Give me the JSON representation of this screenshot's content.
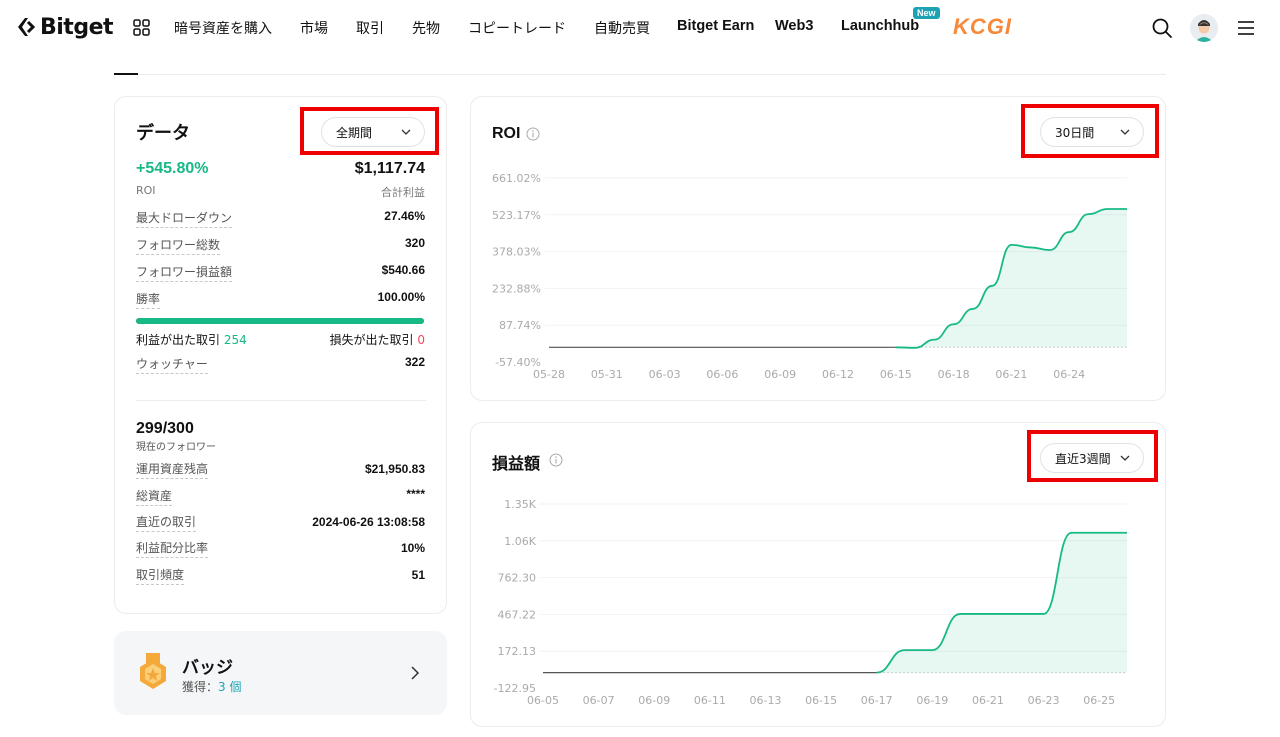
{
  "nav": {
    "brand": "Bitget",
    "items": [
      {
        "label": "暗号資産を購入"
      },
      {
        "label": "市場"
      },
      {
        "label": "取引"
      },
      {
        "label": "先物"
      },
      {
        "label": "コピートレード"
      },
      {
        "label": "自動売買"
      },
      {
        "label": "Bitget Earn"
      },
      {
        "label": "Web3"
      },
      {
        "label": "Launchhub"
      }
    ],
    "new_badge": "New",
    "kcgi": "KCGI",
    "icons": [
      "grid-icon",
      "search-icon",
      "avatar",
      "menu-icon"
    ]
  },
  "data_card": {
    "title": "データ",
    "period": "全期間",
    "roi_value": "+545.80%",
    "roi_label": "ROI",
    "total_profit_value": "$1,117.74",
    "total_profit_label": "合計利益",
    "rows": [
      {
        "label": "最大ドローダウン",
        "value": "27.46%"
      },
      {
        "label": "フォロワー総数",
        "value": "320"
      },
      {
        "label": "フォロワー損益額",
        "value": "$540.66"
      },
      {
        "label": "勝率",
        "value": "100.00%"
      }
    ],
    "win_rate_fraction": 1.0,
    "profit_trades_label": "利益が出た取引",
    "profit_trades_value": "254",
    "loss_trades_label": "損失が出た取引",
    "loss_trades_value": "0",
    "watchers_label": "ウォッチャー",
    "watchers_value": "322",
    "followers_value": "299/300",
    "followers_label": "現在のフォロワー",
    "rows2": [
      {
        "label": "運用資産残高",
        "value": "$21,950.83"
      },
      {
        "label": "総資産",
        "value": "****"
      },
      {
        "label": "直近の取引",
        "value": "2024-06-26 13:08:58"
      },
      {
        "label": "利益配分比率",
        "value": "10%"
      },
      {
        "label": "取引頻度",
        "value": "51"
      }
    ]
  },
  "badge_card": {
    "title": "バッジ",
    "earned_label": "獲得：",
    "earned_value": "3 個"
  },
  "colors": {
    "accent_green": "#17b987",
    "loss_red": "#f6465d",
    "link_teal": "#1da2b4",
    "highlight_red": "#ee0000"
  },
  "chart_data": [
    {
      "type": "area",
      "title": "ROI",
      "period": "30日間",
      "y_ticks": [
        "661.02%",
        "523.17%",
        "378.03%",
        "232.88%",
        "87.74%",
        "-57.40%"
      ],
      "x_ticks": [
        "05-28",
        "05-31",
        "06-03",
        "06-06",
        "06-09",
        "06-12",
        "06-15",
        "06-18",
        "06-21",
        "06-24"
      ],
      "ylim": [
        -57.4,
        661.02
      ],
      "x": [
        "05-28",
        "05-29",
        "05-30",
        "05-31",
        "06-01",
        "06-02",
        "06-03",
        "06-04",
        "06-05",
        "06-06",
        "06-07",
        "06-08",
        "06-09",
        "06-10",
        "06-11",
        "06-12",
        "06-13",
        "06-14",
        "06-15",
        "06-16",
        "06-17",
        "06-18",
        "06-19",
        "06-20",
        "06-21",
        "06-22",
        "06-23",
        "06-24",
        "06-25",
        "06-26",
        "06-27"
      ],
      "values": [
        0,
        0,
        0,
        0,
        0,
        0,
        0,
        0,
        0,
        0,
        0,
        0,
        0,
        0,
        0,
        0,
        0,
        0,
        0,
        -2,
        30,
        90,
        150,
        240,
        400,
        390,
        380,
        450,
        520,
        540,
        540
      ],
      "negative_color": "#f6465d",
      "positive_color": "#17b987"
    },
    {
      "type": "area",
      "title": "損益額",
      "period": "直近3週間",
      "y_ticks": [
        "1.35K",
        "1.06K",
        "762.30",
        "467.22",
        "172.13",
        "-122.95"
      ],
      "x_ticks": [
        "06-05",
        "06-07",
        "06-09",
        "06-11",
        "06-13",
        "06-15",
        "06-17",
        "06-19",
        "06-21",
        "06-23",
        "06-25"
      ],
      "ylim": [
        -122.95,
        1350
      ],
      "x": [
        "06-05",
        "06-06",
        "06-07",
        "06-08",
        "06-09",
        "06-10",
        "06-11",
        "06-12",
        "06-13",
        "06-14",
        "06-15",
        "06-16",
        "06-17",
        "06-18",
        "06-19",
        "06-20",
        "06-21",
        "06-22",
        "06-23",
        "06-24",
        "06-25",
        "06-26"
      ],
      "values": [
        0,
        0,
        0,
        0,
        0,
        0,
        0,
        0,
        0,
        0,
        0,
        0,
        0,
        180,
        180,
        470,
        470,
        470,
        470,
        1120,
        1120,
        1120
      ],
      "negative_color": "#f6465d",
      "positive_color": "#17b987"
    }
  ]
}
